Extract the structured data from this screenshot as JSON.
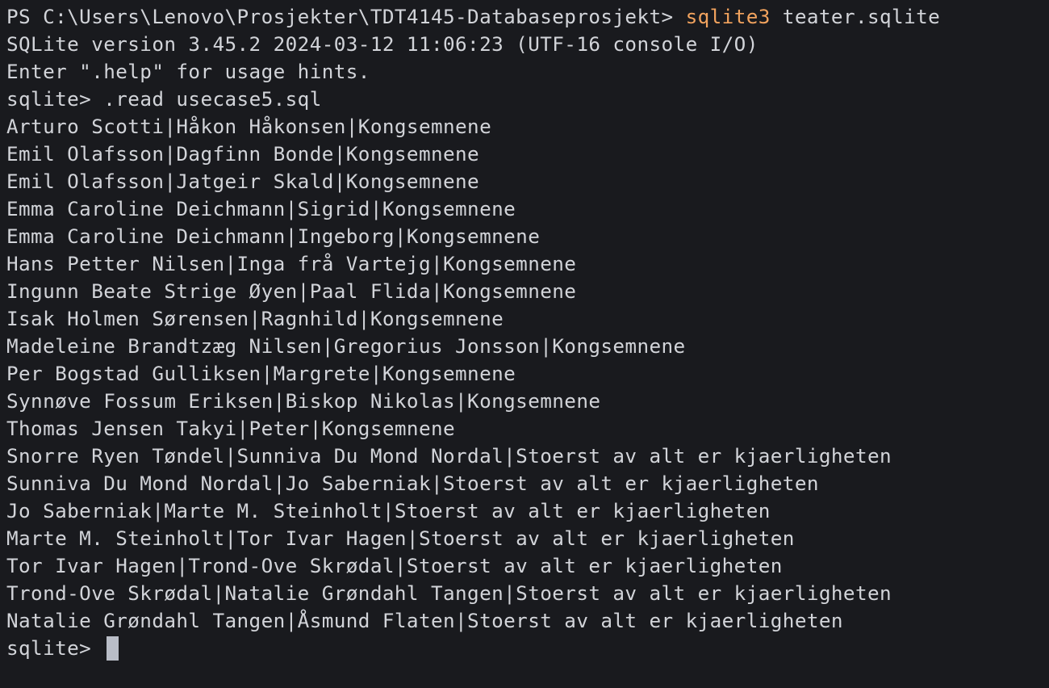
{
  "terminal": {
    "colors": {
      "background": "#191a1e",
      "text": "#d2d4d9",
      "command_highlight": "#f2a35e",
      "cursor": "#b9bdc7"
    },
    "shell_prompt": "PS C:\\Users\\Lenovo\\Prosjekter\\TDT4145-Databaseprosjekt> ",
    "shell_command": "sqlite3",
    "shell_argument": " teater.sqlite",
    "version_line": "SQLite version 3.45.2 2024-03-12 11:06:23 (UTF-16 console I/O)",
    "hint_line": "Enter \".help\" for usage hints.",
    "sqlite_prompt": "sqlite>",
    "read_command": " .read usecase5.sql",
    "output_rows": [
      "Arturo Scotti|Håkon Håkonsen|Kongsemnene",
      "Emil Olafsson|Dagfinn Bonde|Kongsemnene",
      "Emil Olafsson|Jatgeir Skald|Kongsemnene",
      "Emma Caroline Deichmann|Sigrid|Kongsemnene",
      "Emma Caroline Deichmann|Ingeborg|Kongsemnene",
      "Hans Petter Nilsen|Inga frå Vartejg|Kongsemnene",
      "Ingunn Beate Strige Øyen|Paal Flida|Kongsemnene",
      "Isak Holmen Sørensen|Ragnhild|Kongsemnene",
      "Madeleine Brandtzæg Nilsen|Gregorius Jonsson|Kongsemnene",
      "Per Bogstad Gulliksen|Margrete|Kongsemnene",
      "Synnøve Fossum Eriksen|Biskop Nikolas|Kongsemnene",
      "Thomas Jensen Takyi|Peter|Kongsemnene",
      "Snorre Ryen Tøndel|Sunniva Du Mond Nordal|Stoerst av alt er kjaerligheten",
      "Sunniva Du Mond Nordal|Jo Saberniak|Stoerst av alt er kjaerligheten",
      "Jo Saberniak|Marte M. Steinholt|Stoerst av alt er kjaerligheten",
      "Marte M. Steinholt|Tor Ivar Hagen|Stoerst av alt er kjaerligheten",
      "Tor Ivar Hagen|Trond-Ove Skrødal|Stoerst av alt er kjaerligheten",
      "Trond-Ove Skrødal|Natalie Grøndahl Tangen|Stoerst av alt er kjaerligheten",
      "Natalie Grøndahl Tangen|Åsmund Flaten|Stoerst av alt er kjaerligheten"
    ],
    "final_prompt": "sqlite> "
  }
}
